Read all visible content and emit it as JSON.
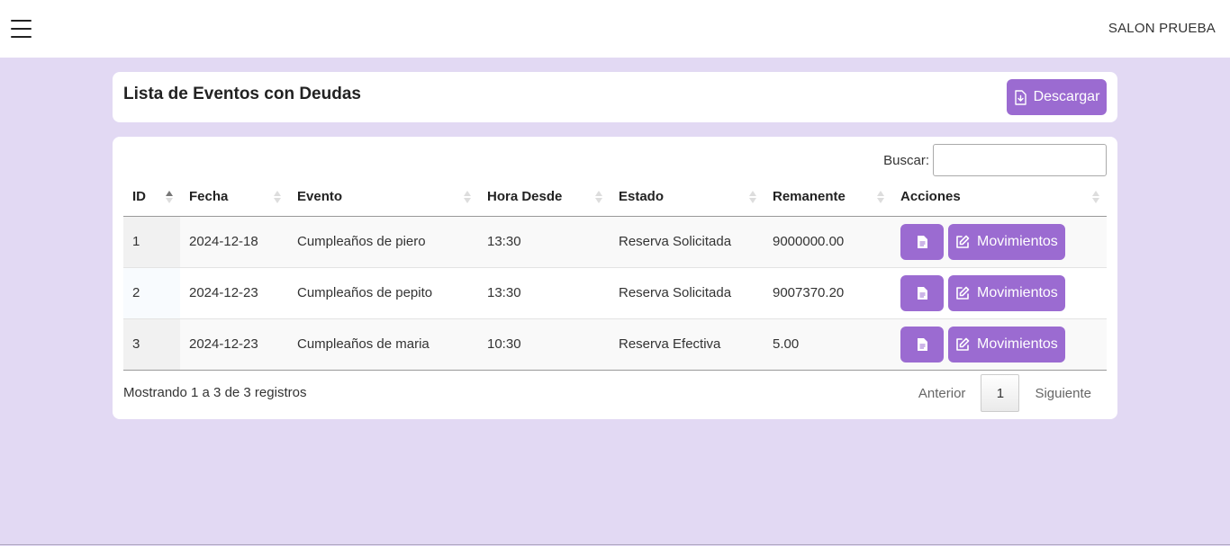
{
  "header": {
    "brand": "SALON PRUEBA"
  },
  "page": {
    "title": "Lista de Eventos con Deudas",
    "download_label": "Descargar"
  },
  "search": {
    "label": "Buscar:",
    "value": ""
  },
  "table": {
    "columns": [
      "ID",
      "Fecha",
      "Evento",
      "Hora Desde",
      "Estado",
      "Remanente",
      "Acciones"
    ],
    "rows": [
      {
        "id": "1",
        "fecha": "2024-12-18",
        "evento": "Cumpleaños de piero",
        "hora": "13:30",
        "estado": "Reserva Solicitada",
        "remanente": "9000000.00"
      },
      {
        "id": "2",
        "fecha": "2024-12-23",
        "evento": "Cumpleaños de pepito",
        "hora": "13:30",
        "estado": "Reserva Solicitada",
        "remanente": "9007370.20"
      },
      {
        "id": "3",
        "fecha": "2024-12-23",
        "evento": "Cumpleaños de maria",
        "hora": "10:30",
        "estado": "Reserva Efectiva",
        "remanente": "5.00"
      }
    ],
    "action_label": "Movimientos"
  },
  "footer": {
    "info": "Mostrando 1 a 3 de 3 registros",
    "prev": "Anterior",
    "page": "1",
    "next": "Siguiente"
  },
  "colors": {
    "accent": "#9b6bd1",
    "background": "#e2d9f3"
  }
}
